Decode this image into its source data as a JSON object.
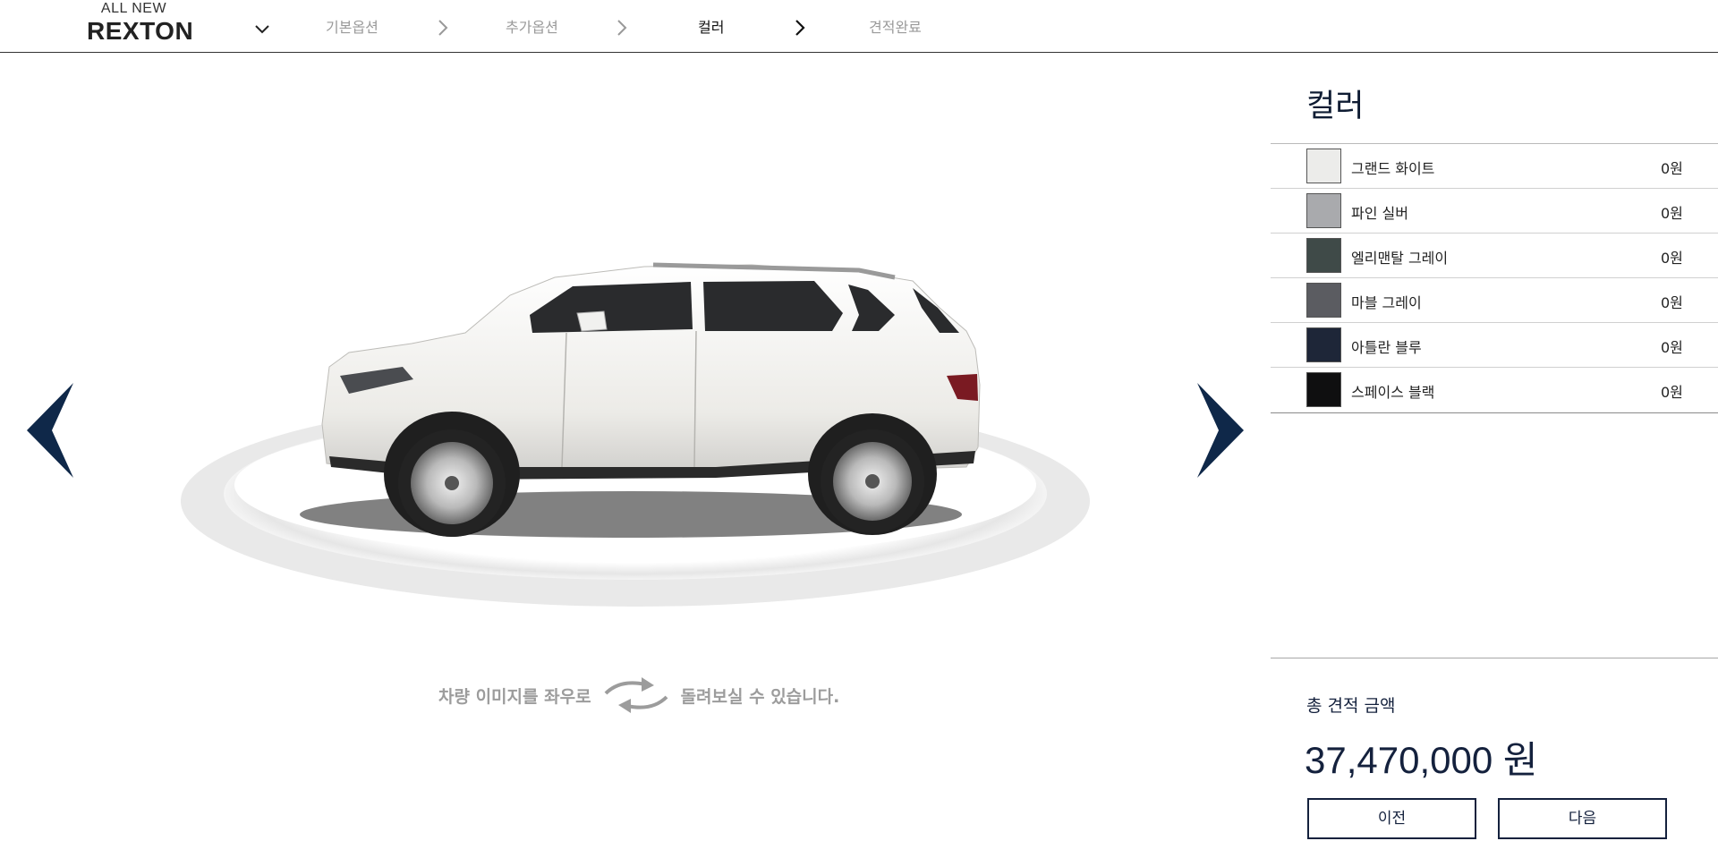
{
  "header": {
    "logo_top": "ALL NEW",
    "logo_main": "REXTON",
    "steps": [
      {
        "label": "기본옵션",
        "active": false
      },
      {
        "label": "추가옵션",
        "active": false
      },
      {
        "label": "컬러",
        "active": true
      },
      {
        "label": "견적완료",
        "active": false
      }
    ]
  },
  "stage": {
    "rotate_hint_left": "차량 이미지를 좌우로",
    "rotate_hint_right": "돌려보실 수 있습니다.",
    "prev_icon": "chevron-left-icon",
    "next_icon": "chevron-right-icon"
  },
  "panel": {
    "title": "컬러",
    "colors": [
      {
        "name": "그랜드 화이트",
        "price": "0원",
        "swatch": "#ececea"
      },
      {
        "name": "파인 실버",
        "price": "0원",
        "swatch": "#a9aaad"
      },
      {
        "name": "엘리맨탈 그레이",
        "price": "0원",
        "swatch": "#3f4a48"
      },
      {
        "name": "마블 그레이",
        "price": "0원",
        "swatch": "#5b5c61"
      },
      {
        "name": "아틀란 블루",
        "price": "0원",
        "swatch": "#1e2638"
      },
      {
        "name": "스페이스 블랙",
        "price": "0원",
        "swatch": "#0f0f10"
      }
    ],
    "total_label": "총 견적 금액",
    "total_amount": "37,470,000 원",
    "prev_button": "이전",
    "next_button": "다음"
  },
  "colors": {
    "accent": "#14213d",
    "nav_arrow": "#0f2849",
    "inactive_step": "#9a9a9a"
  }
}
